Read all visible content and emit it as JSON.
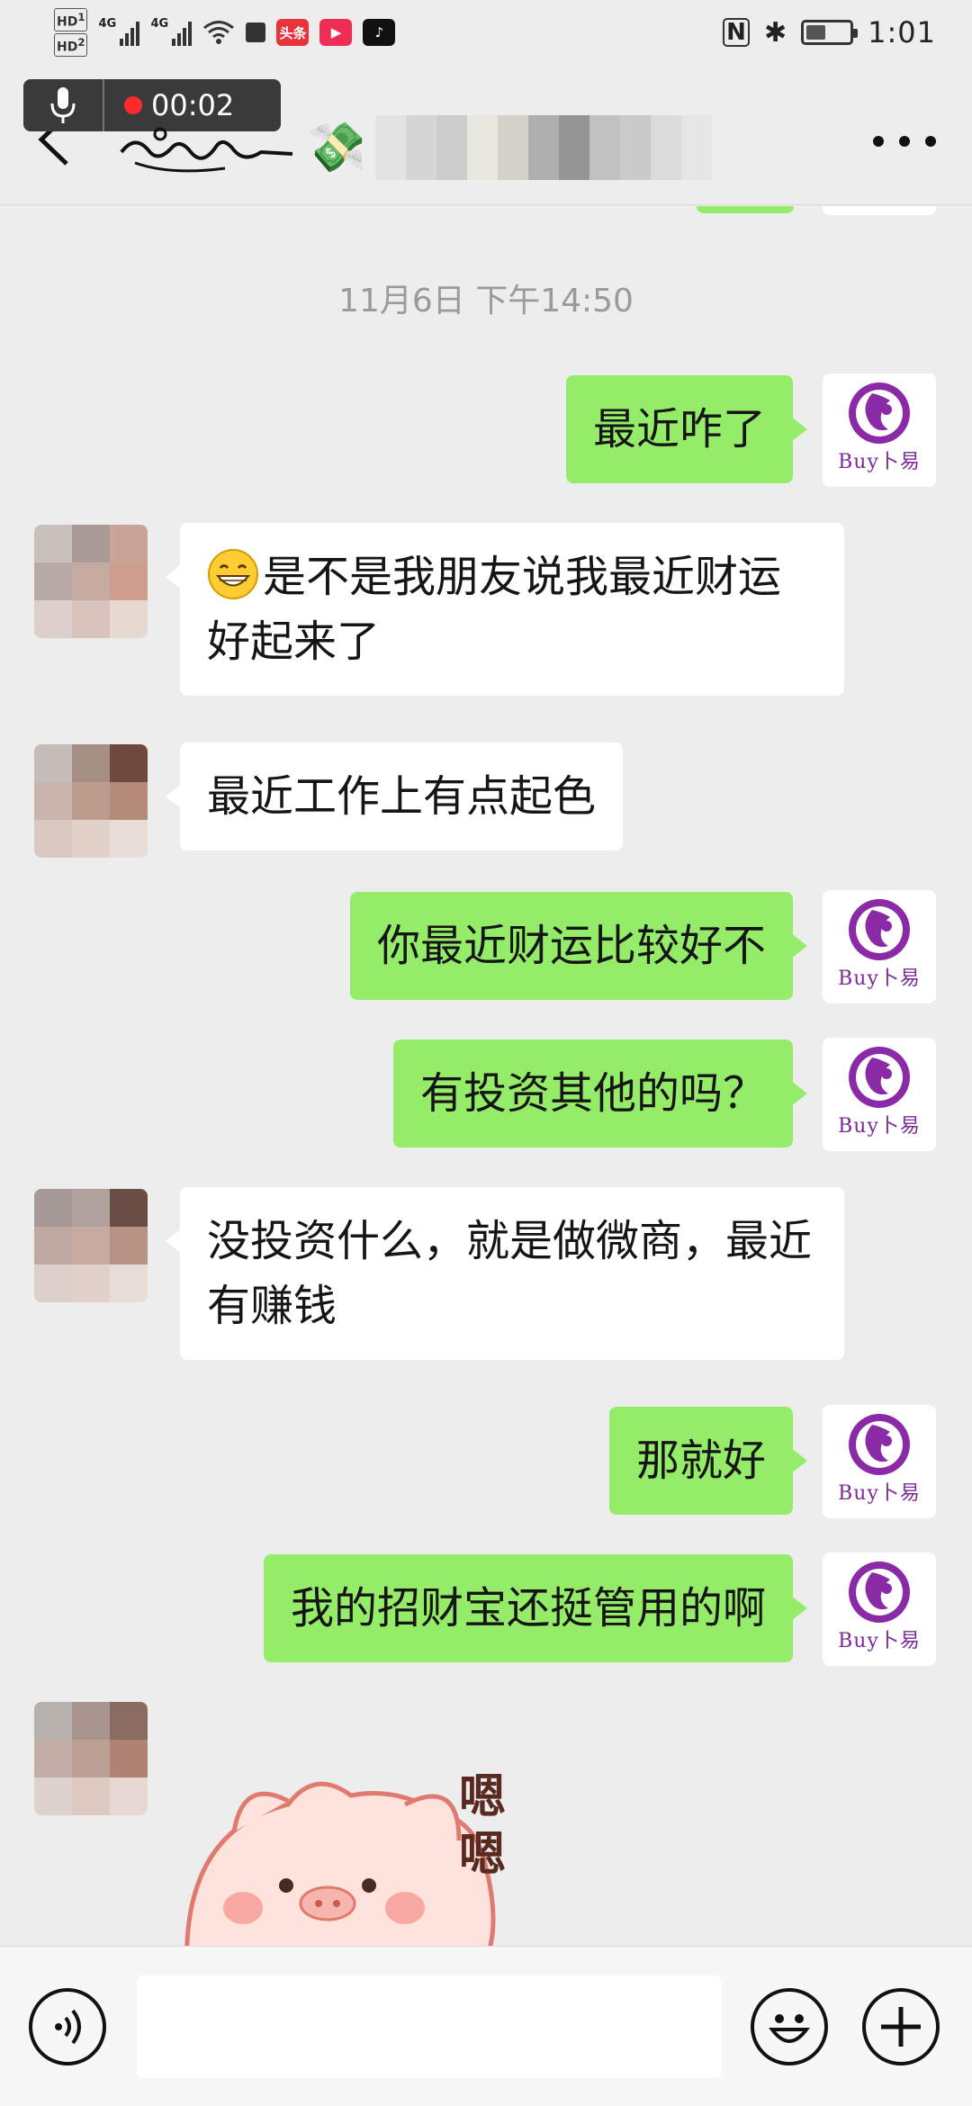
{
  "status_bar": {
    "time": "1:01",
    "network_labels": [
      "HD",
      "1",
      "HD",
      "2",
      "4G",
      "4G"
    ],
    "app_badges": [
      {
        "name": "toutiao-icon",
        "text": "头条",
        "color": "#e8333a"
      },
      {
        "name": "video-app-icon",
        "text": "▶",
        "color": "#f02e55"
      },
      {
        "name": "tiktok-icon",
        "text": "♪",
        "color": "#111111"
      }
    ],
    "battery_level": 0.45
  },
  "recording": {
    "timer": "00:02",
    "mic_icon": "microphone-icon"
  },
  "nav": {
    "back_icon": "chevron-left-icon",
    "title_icon": "money-with-wings-icon",
    "title_glyph": "💸",
    "more_icon": "more-dots-icon"
  },
  "chat": {
    "timestamp": "11月6日 下午14:50",
    "brand_avatar": {
      "name": "Buy卜易",
      "color": "#7a2a98"
    },
    "messages": [
      {
        "sender": "me",
        "text": "最近咋了"
      },
      {
        "sender": "them",
        "emoji": "grinning-face-icon",
        "text": "是不是我朋友说我最近财运好起来了"
      },
      {
        "sender": "them",
        "text": "最近工作上有点起色"
      },
      {
        "sender": "me",
        "text": "你最近财运比较好不"
      },
      {
        "sender": "me",
        "text": "有投资其他的吗？"
      },
      {
        "sender": "them",
        "text": "没投资什么，就是做微商，最近有赚钱"
      },
      {
        "sender": "me",
        "text": "那就好"
      },
      {
        "sender": "me",
        "text": "我的招财宝还挺管用的啊"
      },
      {
        "sender": "them",
        "sticker": "pig-sticker",
        "sticker_text": "嗯嗯"
      }
    ]
  },
  "input_bar": {
    "voice_icon": "voice-input-icon",
    "emoji_icon": "emoji-icon",
    "plus_icon": "plus-icon",
    "input_value": ""
  },
  "colors": {
    "background": "#ededed",
    "my_bubble": "#95ec69",
    "their_bubble": "#ffffff",
    "recording_dot": "#ff2a2a"
  }
}
